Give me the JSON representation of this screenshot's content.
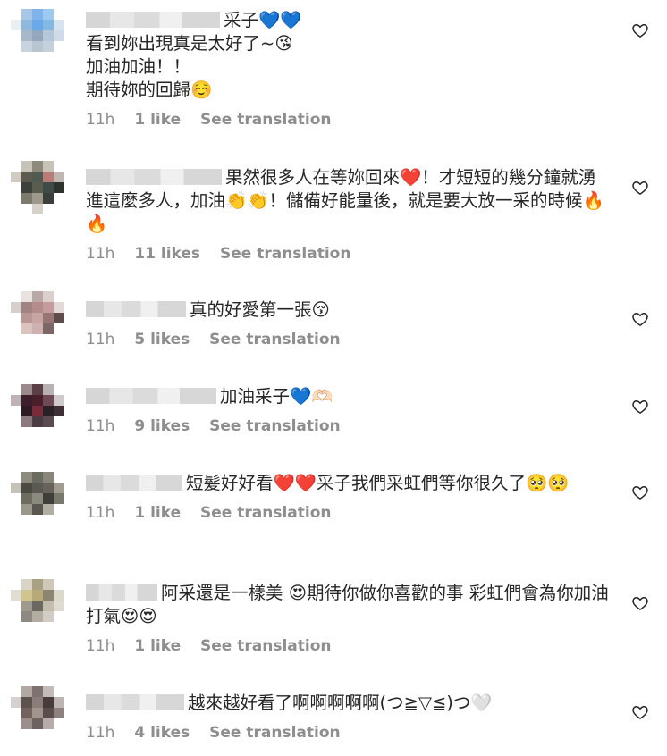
{
  "comments": [
    {
      "text": "采子💙💙\n看到妳出現真是太好了~😘\n加油加油！！\n期待妳的回歸☺️",
      "time": "11h",
      "likes": "1 like",
      "translate": "See translation"
    },
    {
      "text": "果然很多人在等妳回來❤️！才短短的幾分鐘就湧進這麼多人，加油👏👏！儲備好能量後，就是要大放一采的時候🔥🔥",
      "time": "11h",
      "likes": "11 likes",
      "translate": "See translation"
    },
    {
      "text": "真的好愛第一張😚",
      "time": "11h",
      "likes": "5 likes",
      "translate": "See translation"
    },
    {
      "text": "加油采子💙🫶🏻",
      "time": "11h",
      "likes": "9 likes",
      "translate": "See translation"
    },
    {
      "text": "短髮好好看❤️❤️采子我們采虹們等你很久了🥺🥺",
      "time": "11h",
      "likes": "1 like",
      "translate": "See translation"
    },
    {
      "text": "阿采還是一樣美 😍期待你做你喜歡的事 彩虹們會為你加油打氣😍😍",
      "time": "11h",
      "likes": "1 like",
      "translate": "See translation"
    },
    {
      "text": "越來越好看了啊啊啊啊啊(つ≧▽≦)つ🤍",
      "time": "11h",
      "likes": "4 likes",
      "translate": "See translation"
    }
  ],
  "icons": {
    "like": "heart-outline-icon"
  },
  "colors": {
    "text": "#262626",
    "meta": "#8e8e8e"
  }
}
